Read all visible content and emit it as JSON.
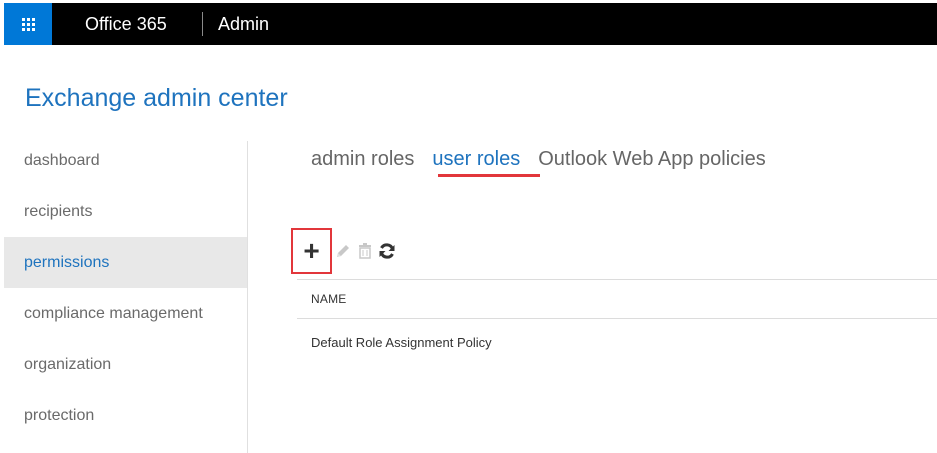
{
  "topbar": {
    "brand": "Office 365",
    "app_name": "Admin"
  },
  "header": {
    "title": "Exchange admin center"
  },
  "nav": {
    "items": [
      {
        "label": "dashboard",
        "active": false
      },
      {
        "label": "recipients",
        "active": false
      },
      {
        "label": "permissions",
        "active": true
      },
      {
        "label": "compliance management",
        "active": false
      },
      {
        "label": "organization",
        "active": false
      },
      {
        "label": "protection",
        "active": false
      }
    ]
  },
  "tabs": [
    {
      "label": "admin roles",
      "active": false
    },
    {
      "label": "user roles",
      "active": true
    },
    {
      "label": "Outlook Web App policies",
      "active": false
    }
  ],
  "toolbar": {
    "add_label": "+",
    "icons": [
      "plus-icon",
      "pencil-icon",
      "trash-icon",
      "refresh-icon"
    ]
  },
  "table": {
    "columns": [
      "NAME"
    ],
    "rows": [
      {
        "name": "Default Role Assignment Policy"
      }
    ]
  },
  "colors": {
    "accent": "#1e73be",
    "waffle": "#0078d7",
    "highlight": "#e2363b",
    "topbar": "#000000"
  }
}
